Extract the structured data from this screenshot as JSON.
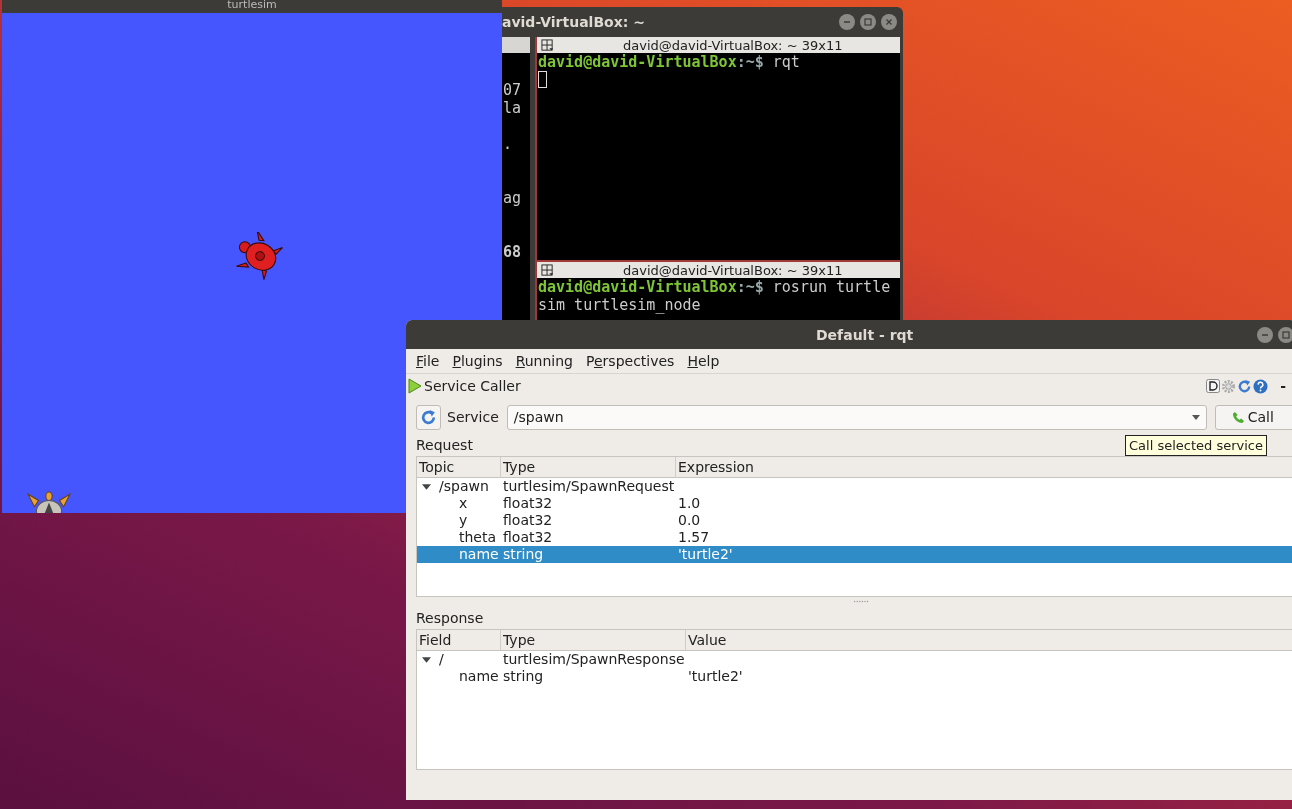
{
  "turtlesim": {
    "title": "turtlesim"
  },
  "terminal": {
    "title": "avid-VirtualBox: ~",
    "left_pane": [
      {
        "text": "07",
        "bold": false
      },
      {
        "text": "la",
        "bold": false
      },
      {
        "text": ".",
        "bold": false
      },
      {
        "text": "ag",
        "bold": false
      },
      {
        "text": "68",
        "bold": true
      }
    ],
    "panes": [
      {
        "header": "david@david-VirtualBox: ~ 39x11",
        "lines": [
          {
            "kind": "prompt",
            "user": "david@david-VirtualBox",
            "path": ":~$",
            "command": "rqt"
          },
          {
            "kind": "cursor"
          }
        ]
      },
      {
        "header": "david@david-VirtualBox: ~ 39x11",
        "lines": [
          {
            "kind": "prompt",
            "user": "david@david-VirtualBox",
            "path": ":~$",
            "command": "rosrun turtle"
          },
          {
            "kind": "output",
            "text": "sim turtlesim_node"
          }
        ]
      }
    ]
  },
  "rqt": {
    "title": "Default - rqt",
    "menu": [
      {
        "key": "F",
        "post": "ile"
      },
      {
        "key": "P",
        "post": "lugins"
      },
      {
        "key": "R",
        "post": "unning"
      },
      {
        "pre": "P",
        "key": "e",
        "post": "rspectives"
      },
      {
        "key": "H",
        "post": "elp"
      }
    ],
    "plugin_title": "Service Caller",
    "plugin_trailing": "-",
    "service_label": "Service",
    "service": "/spawn",
    "call_button": "Call",
    "tooltip": "Call selected service",
    "request_label": "Request",
    "request_table": {
      "columns": [
        "Topic",
        "Type",
        "Expression"
      ],
      "rows": [
        {
          "cells": [
            "/spawn",
            "turtlesim/SpawnRequest"
          ],
          "expanded": true,
          "selected": false,
          "children": [
            {
              "cells": [
                "x",
                "float32",
                "1.0"
              ],
              "selected": false
            },
            {
              "cells": [
                "y",
                "float32",
                "0.0"
              ],
              "selected": false
            },
            {
              "cells": [
                "theta",
                "float32",
                "1.57"
              ],
              "selected": false
            },
            {
              "cells": [
                "name",
                "string",
                "'turtle2'"
              ],
              "selected": true
            }
          ]
        }
      ]
    },
    "response_label": "Response",
    "response_table": {
      "columns": [
        "Field",
        "Type",
        "Value"
      ],
      "rows": [
        {
          "cells": [
            "/",
            "turtlesim/SpawnResponse"
          ],
          "expanded": true,
          "selected": false,
          "children": [
            {
              "cells": [
                "name",
                "string",
                "'turtle2'"
              ],
              "selected": false
            }
          ]
        }
      ]
    }
  }
}
